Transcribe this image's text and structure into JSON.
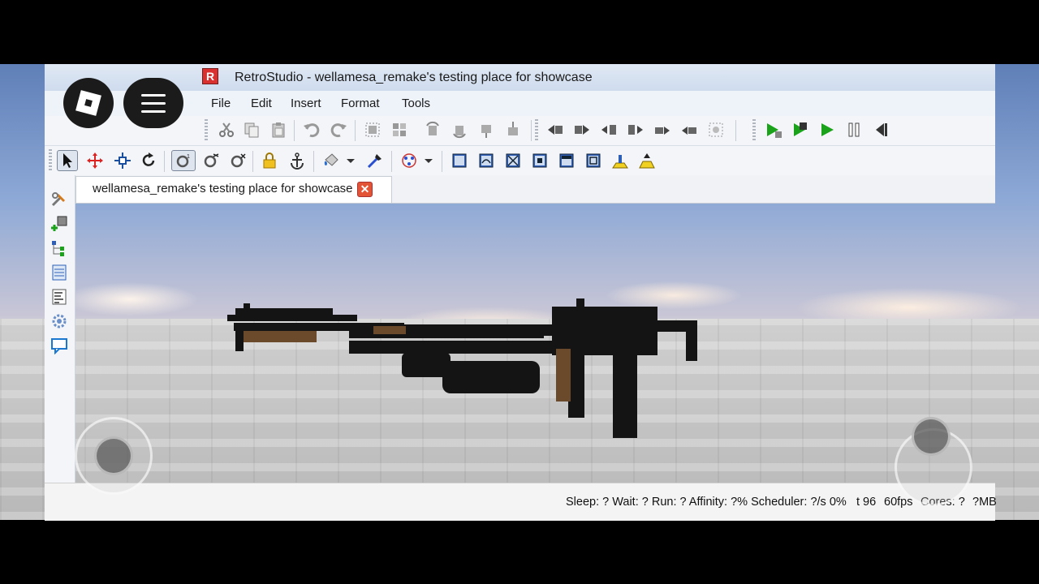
{
  "window": {
    "title": "RetroStudio - wellamesa_remake's testing place for showcase",
    "app_icon_letter": "R"
  },
  "menu": {
    "items": [
      "File",
      "Edit",
      "Insert",
      "Format",
      "Tools"
    ]
  },
  "tabs": [
    {
      "label": "wellamesa_remake's testing place for showcase",
      "close_symbol": "✕"
    }
  ],
  "status": {
    "sleep": "Sleep: ? Wait: ? Run: ? Affinity: ?% Scheduler: ?/s 0%",
    "t": "t 96",
    "fps": "60fps",
    "cores": "Cores: ?",
    "mem": "?MB"
  },
  "toolbar_icons": {
    "row1": [
      "cut-icon",
      "copy-icon",
      "paste-icon",
      "undo-icon",
      "redo-icon",
      "group-icon",
      "ungroup-icon",
      "rotate-left-icon",
      "rotate-right-icon",
      "tilt-icon",
      "tilt-down-icon",
      "move-back-icon",
      "move-forward-icon",
      "move-left-icon",
      "move-right-icon",
      "move-up-icon",
      "move-down-icon",
      "drop-icon",
      "run-icon",
      "play-solo-icon",
      "play-icon",
      "pause-icon",
      "stop-icon"
    ],
    "row2": [
      "select-icon",
      "move-icon",
      "scale-icon",
      "rotate-icon",
      "collision-icon",
      "join-icon",
      "unjoin-icon",
      "lock-icon",
      "anchor-icon",
      "paint-icon",
      "material-icon",
      "grid-icon",
      "surface-icon",
      "smooth-icon",
      "glue-icon",
      "weld-icon",
      "studs-icon",
      "inlet-icon",
      "universal-icon",
      "hinge-icon",
      "motor-icon"
    ]
  },
  "colors": {
    "accent_green": "#1aa31a",
    "title_bg": "#d6e2f1",
    "close_red": "#e35336"
  }
}
